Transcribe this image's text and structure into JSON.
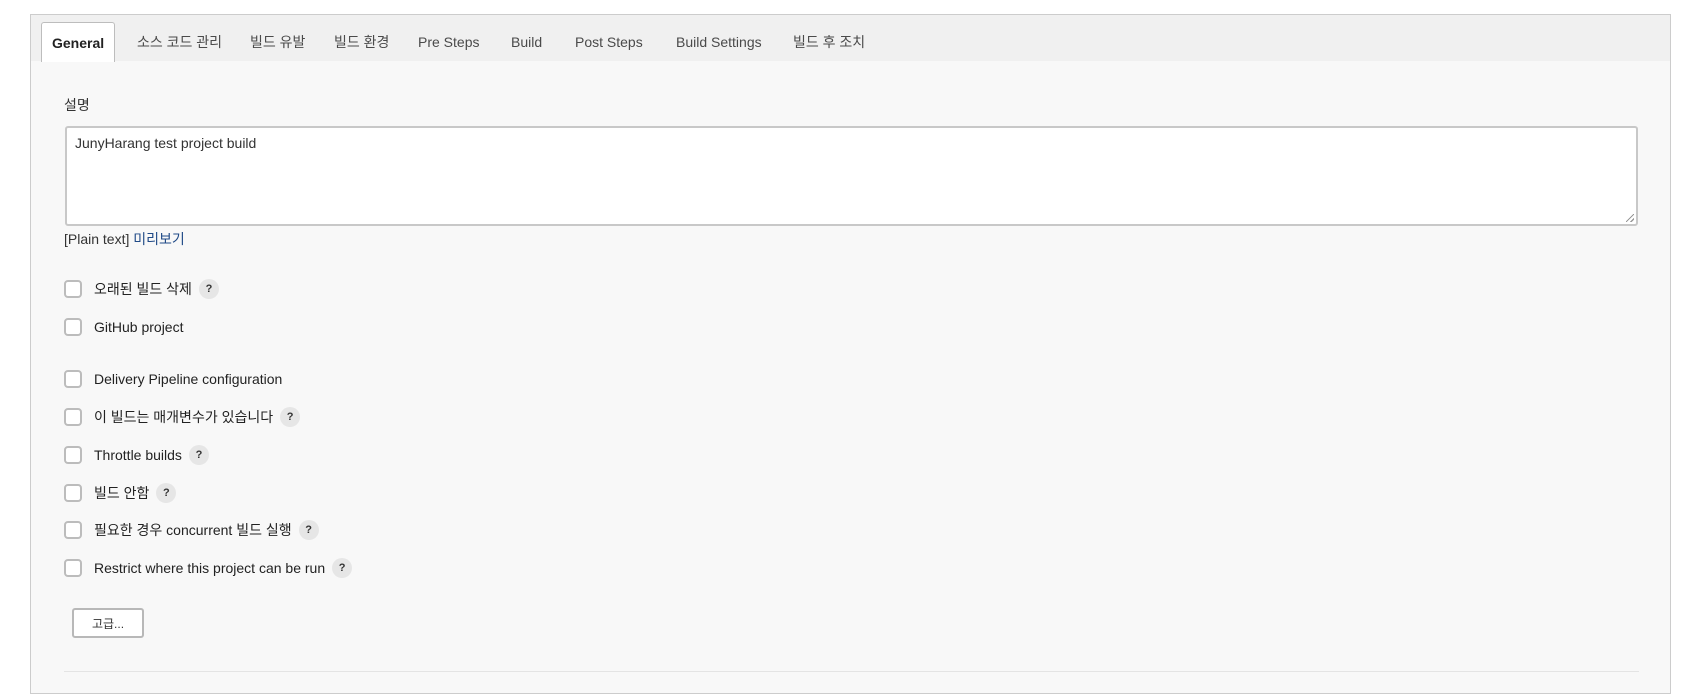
{
  "tabs": [
    {
      "label": "General"
    },
    {
      "label": "소스 코드 관리"
    },
    {
      "label": "빌드 유발"
    },
    {
      "label": "빌드 환경"
    },
    {
      "label": "Pre Steps"
    },
    {
      "label": "Build"
    },
    {
      "label": "Post Steps"
    },
    {
      "label": "Build Settings"
    },
    {
      "label": "빌드 후 조치"
    }
  ],
  "description": {
    "label": "설명",
    "value": "JunyHarang test project build",
    "format_text": "[Plain text]",
    "preview_link": "미리보기"
  },
  "options": [
    {
      "label": "오래된 빌드 삭제",
      "help": "?",
      "checked": false
    },
    {
      "label": "GitHub project",
      "checked": false
    },
    {
      "label": "Delivery Pipeline configuration",
      "checked": false
    },
    {
      "label": "이 빌드는 매개변수가 있습니다",
      "help": "?",
      "checked": false
    },
    {
      "label": "Throttle builds",
      "help": "?",
      "checked": false
    },
    {
      "label": "빌드 안함",
      "help": "?",
      "checked": false
    },
    {
      "label": "필요한 경우 concurrent 빌드 실행",
      "help": "?",
      "checked": false
    },
    {
      "label": "Restrict where this project can be run",
      "help": "?",
      "checked": false
    }
  ],
  "advanced_button": "고급..."
}
